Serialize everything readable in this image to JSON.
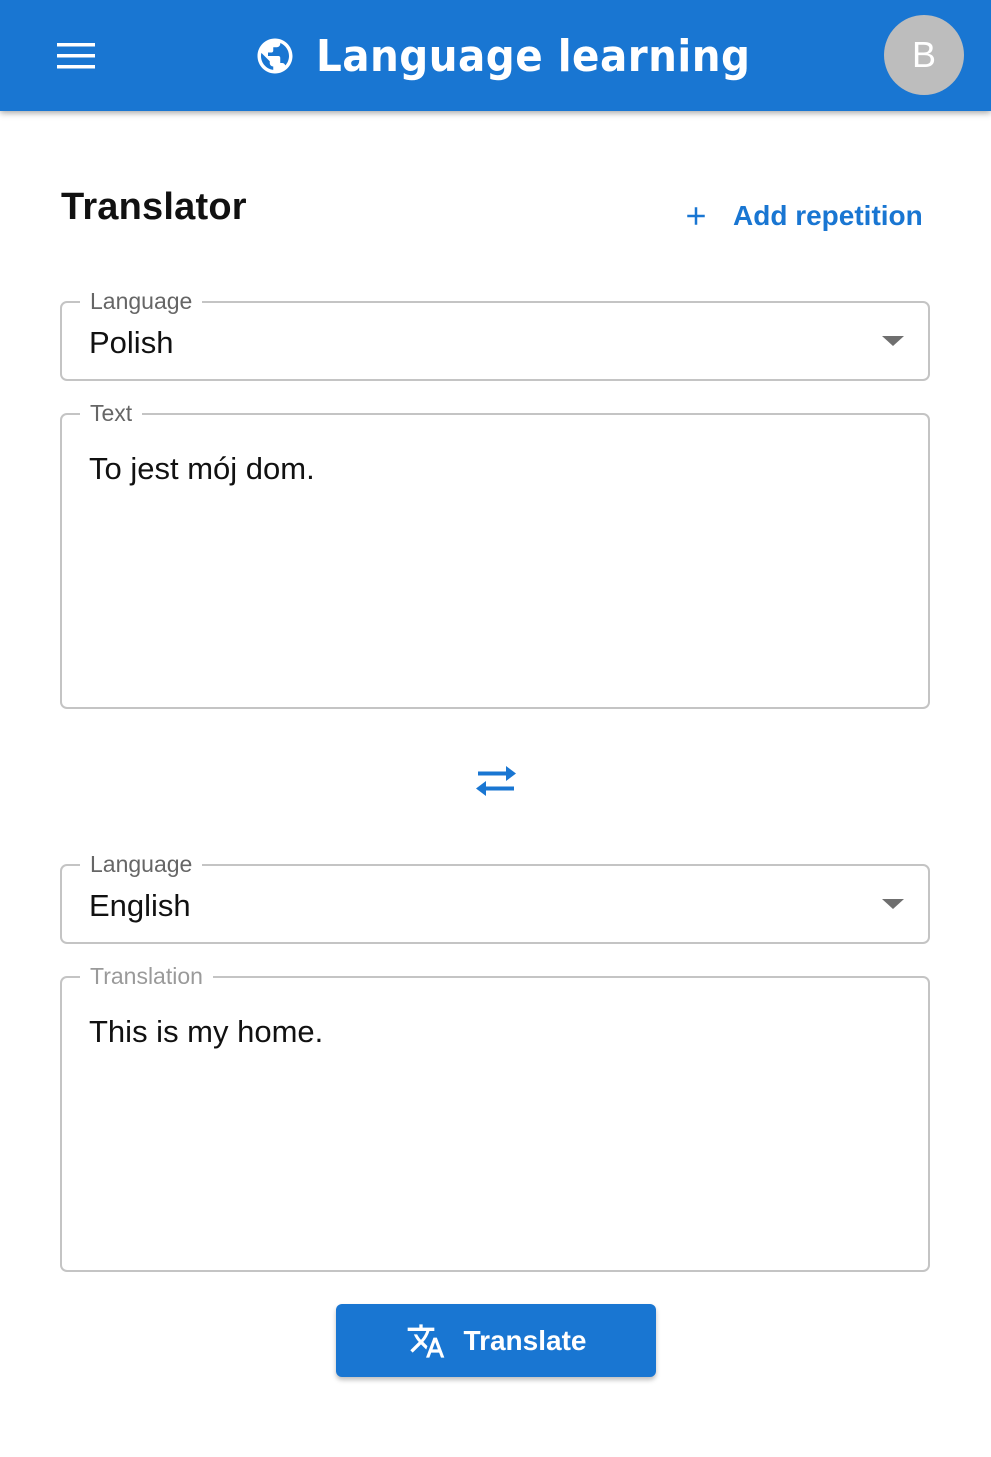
{
  "app": {
    "title": "Language learning",
    "avatar_initial": "B",
    "brand_color": "#1976d2"
  },
  "icons": {
    "menu": "menu-icon",
    "brand": "globe-icon",
    "add": "plus-icon",
    "swap": "swap-icon",
    "translate": "translate-icon",
    "select_caret": "caret-down-icon"
  },
  "page": {
    "title": "Translator",
    "add_repetition_label": "Add repetition"
  },
  "source": {
    "language_label": "Language",
    "language_value": "Polish",
    "text_label": "Text",
    "text_value": "To jest mój dom."
  },
  "target": {
    "language_label": "Language",
    "language_value": "English",
    "translation_label": "Translation",
    "translation_value": "This is my home."
  },
  "actions": {
    "translate_label": "Translate"
  }
}
